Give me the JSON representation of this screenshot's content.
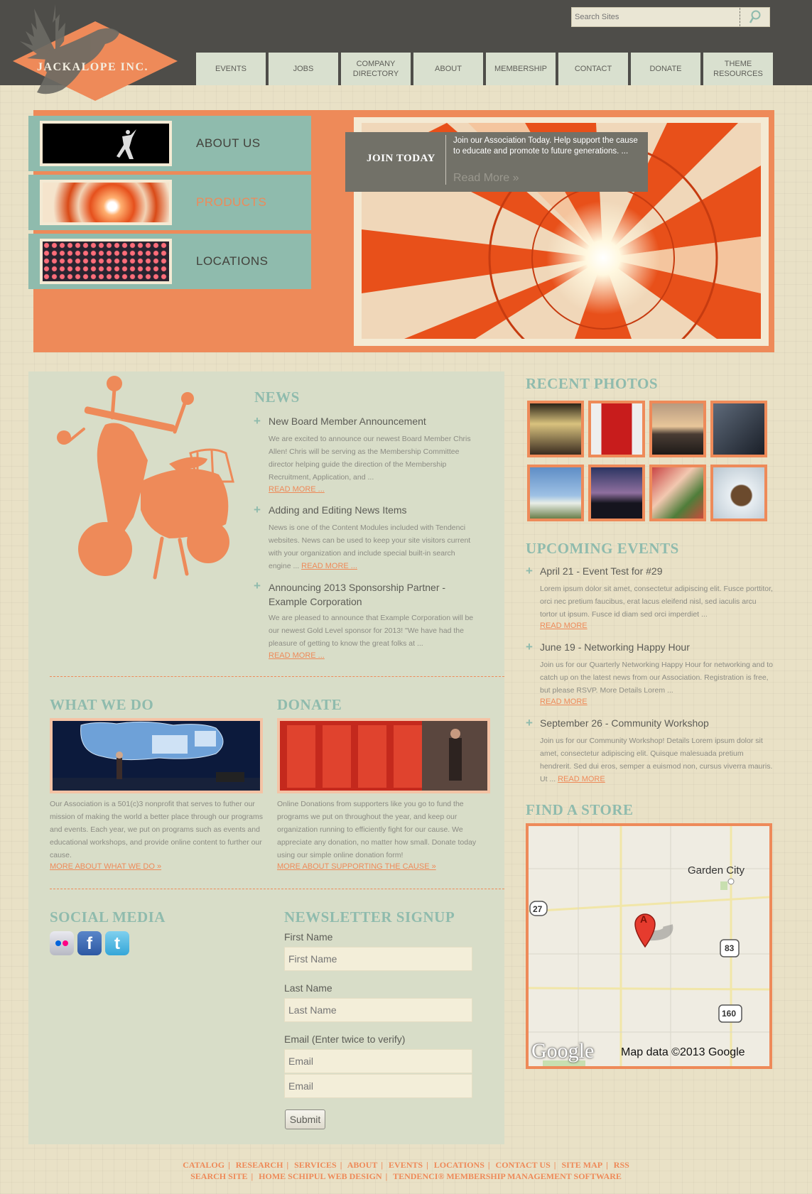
{
  "brand": {
    "name": "JACKALOPE INC."
  },
  "search": {
    "placeholder": "Search Sites"
  },
  "nav": [
    {
      "label": "EVENTS"
    },
    {
      "label": "JOBS"
    },
    {
      "label": "COMPANY DIRECTORY"
    },
    {
      "label": "ABOUT"
    },
    {
      "label": "MEMBERSHIP"
    },
    {
      "label": "CONTACT"
    },
    {
      "label": "DONATE"
    },
    {
      "label": "THEME RESOURCES"
    }
  ],
  "hero_tiles": [
    {
      "label": "ABOUT US"
    },
    {
      "label": "PRODUCTS"
    },
    {
      "label": "LOCATIONS"
    }
  ],
  "join": {
    "title": "JOIN TODAY",
    "text": "Join our Association Today. Help support the cause to educate and promote to future generations. ...",
    "more": "Read More »"
  },
  "news": {
    "heading": "NEWS",
    "items": [
      {
        "title": "New Board Member Announcement",
        "body": "We are excited to announce our newest Board Member Chris Allen! Chris will be serving as the Membership Committee director helping guide the direction of the Membership Recruitment, Application, and ...",
        "more": "READ MORE ..."
      },
      {
        "title": "Adding and Editing News Items",
        "body": "News is one of the Content Modules included with Tendenci websites. News can be used to keep your site visitors current with your organization and include special built-in search engine ...",
        "more": "READ MORE ..."
      },
      {
        "title": "Announcing 2013 Sponsorship Partner - Example Corporation",
        "body": "We are pleased to announce that Example Corporation will be our newest Gold Level sponsor for 2013! \"We have had the pleasure of getting to know the great folks at ...",
        "more": "READ MORE ..."
      }
    ]
  },
  "what_we_do": {
    "heading": "WHAT WE DO",
    "body": "Our Association is a 501(c)3 nonprofit that serves to futher our mission of making the world a better place through our programs and events. Each year, we put on programs such as events and educational workshops, and provide online content to further our cause.",
    "more": "MORE ABOUT WHAT WE DO »"
  },
  "donate": {
    "heading": "DONATE",
    "body": "Online Donations from supporters like you go to fund the programs we put on throughout the year, and keep our organization running to efficiently fight for our cause. We appreciate any donation, no matter how small. Donate today using our simple online donation form!",
    "more": "MORE ABOUT SUPPORTING THE CAUSE »"
  },
  "social": {
    "heading": "SOCIAL MEDIA",
    "icons": [
      "flickr-icon",
      "facebook-icon",
      "twitter-icon"
    ]
  },
  "newsletter": {
    "heading": "NEWSLETTER SIGNUP",
    "first_label": "First Name",
    "first_placeholder": "First Name",
    "last_label": "Last Name",
    "last_placeholder": "Last Name",
    "email_label": "Email (Enter twice to verify)",
    "email_placeholder": "Email",
    "email2_placeholder": "Email",
    "submit": "Submit"
  },
  "photos": {
    "heading": "RECENT PHOTOS"
  },
  "events": {
    "heading": "UPCOMING EVENTS",
    "items": [
      {
        "title": "April 21 - Event Test for #29",
        "body": "Lorem ipsum dolor sit amet, consectetur adipiscing elit. Fusce porttitor, orci nec pretium faucibus, erat lacus eleifend nisl, sed iaculis arcu tortor ut ipsum. Fusce id diam sed orci imperdiet ...",
        "more": "READ MORE"
      },
      {
        "title": "June 19 - Networking Happy Hour",
        "body": "Join us for our Quarterly Networking Happy Hour for networking and to catch up on the latest news from our Association. Registration is free, but please RSVP. More Details Lorem ...",
        "more": "READ MORE"
      },
      {
        "title": "September 26 - Community Workshop",
        "body": "Join us for our Community Workshop! Details Lorem ipsum dolor sit amet, consectetur adipiscing elit. Quisque malesuada pretium hendrerit. Sed dui eros, semper a euismod non, cursus viverra mauris. Ut ...",
        "more": "READ MORE"
      }
    ]
  },
  "store": {
    "heading": "FIND A STORE",
    "city": "Garden City",
    "route_27": "27",
    "route_83": "83",
    "route_160": "160",
    "marker": "A",
    "google": "Google",
    "map_data": "Map data ©2013 Google"
  },
  "footer": {
    "row1": [
      "CATALOG",
      "RESEARCH",
      "SERVICES",
      "ABOUT",
      "EVENTS",
      "LOCATIONS",
      "CONTACT US",
      "SITE MAP",
      "RSS"
    ],
    "row2": [
      "SEARCH SITE",
      "HOME SCHIPUL WEB DESIGN",
      "TENDENCI® MEMBERSHIP MANAGEMENT SOFTWARE"
    ]
  },
  "colors": {
    "accent": "#ee8a59",
    "teal": "#8fbbad",
    "header": "#4e4d49",
    "background": "#e9e1c6"
  }
}
